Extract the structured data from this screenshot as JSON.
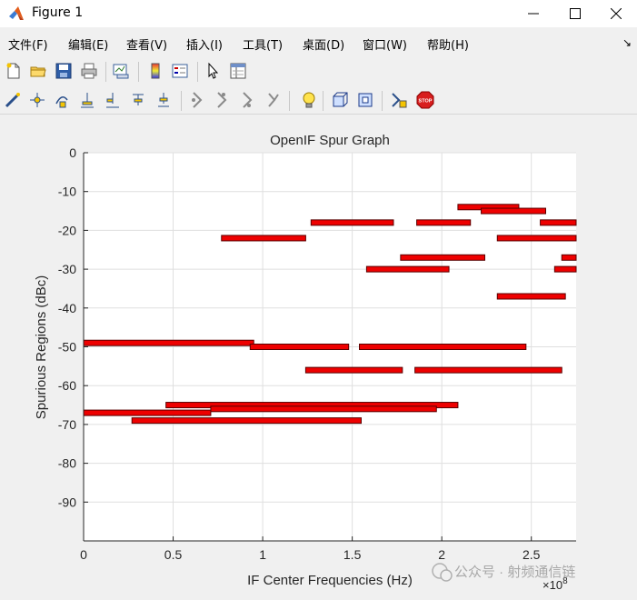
{
  "window": {
    "title": "Figure 1"
  },
  "menu": [
    "文件(F)",
    "编辑(E)",
    "查看(V)",
    "插入(I)",
    "工具(T)",
    "桌面(D)",
    "窗口(W)",
    "帮助(H)"
  ],
  "toolbar1": [
    "new-figure",
    "open-file",
    "save",
    "print",
    "link-plot",
    "colorbar",
    "legend",
    "pointer",
    "property-editor"
  ],
  "toolbar2": [
    "brush",
    "data-cursor",
    "rotate",
    "pan",
    "zoom-in",
    "zoom-out",
    "reset-view",
    "select",
    "plot-tools",
    "insert-text",
    "insert-arrow",
    "insert-rect",
    "stop"
  ],
  "chart_data": {
    "type": "bar",
    "title": "OpenIF Spur Graph",
    "xlabel": "IF Center Frequencies (Hz)",
    "ylabel": "Spurious Regions (dBc)",
    "x_exponent_label": "×10",
    "x_exponent_power": "8",
    "xlim": [
      0,
      2.75
    ],
    "ylim": [
      -100,
      0
    ],
    "x_unit_multiplier": 100000000,
    "xticks": [
      "0",
      "0.5",
      "1",
      "1.5",
      "2",
      "2.5"
    ],
    "yticks": [
      "0",
      "-10",
      "-20",
      "-30",
      "-40",
      "-50",
      "-60",
      "-70",
      "-80",
      "-90"
    ],
    "grid": true,
    "bar_color": "#ee0000",
    "bar_edge_color": "#5a0000",
    "regions": [
      {
        "x0": 0.0,
        "x1": 0.95,
        "level": -49
      },
      {
        "x0": 0.93,
        "x1": 1.48,
        "level": -50
      },
      {
        "x0": 1.54,
        "x1": 2.47,
        "level": -50
      },
      {
        "x0": 0.77,
        "x1": 1.24,
        "level": -22
      },
      {
        "x0": 1.27,
        "x1": 1.73,
        "level": -18
      },
      {
        "x0": 1.86,
        "x1": 2.16,
        "level": -18
      },
      {
        "x0": 2.09,
        "x1": 2.43,
        "level": -14
      },
      {
        "x0": 2.22,
        "x1": 2.58,
        "level": -15
      },
      {
        "x0": 2.55,
        "x1": 2.75,
        "level": -18
      },
      {
        "x0": 2.31,
        "x1": 2.75,
        "level": -22
      },
      {
        "x0": 1.77,
        "x1": 2.24,
        "level": -27
      },
      {
        "x0": 1.58,
        "x1": 2.04,
        "level": -30
      },
      {
        "x0": 2.67,
        "x1": 2.75,
        "level": -27
      },
      {
        "x0": 2.63,
        "x1": 2.75,
        "level": -30
      },
      {
        "x0": 2.31,
        "x1": 2.69,
        "level": -37
      },
      {
        "x0": 1.24,
        "x1": 1.78,
        "level": -56
      },
      {
        "x0": 1.85,
        "x1": 2.67,
        "level": -56
      },
      {
        "x0": 0.46,
        "x1": 2.09,
        "level": -65
      },
      {
        "x0": 0.71,
        "x1": 1.97,
        "level": -66
      },
      {
        "x0": 0.0,
        "x1": 0.71,
        "level": -67
      },
      {
        "x0": 0.27,
        "x1": 1.55,
        "level": -69
      }
    ]
  },
  "watermark": "公众号 · 射频通信链"
}
